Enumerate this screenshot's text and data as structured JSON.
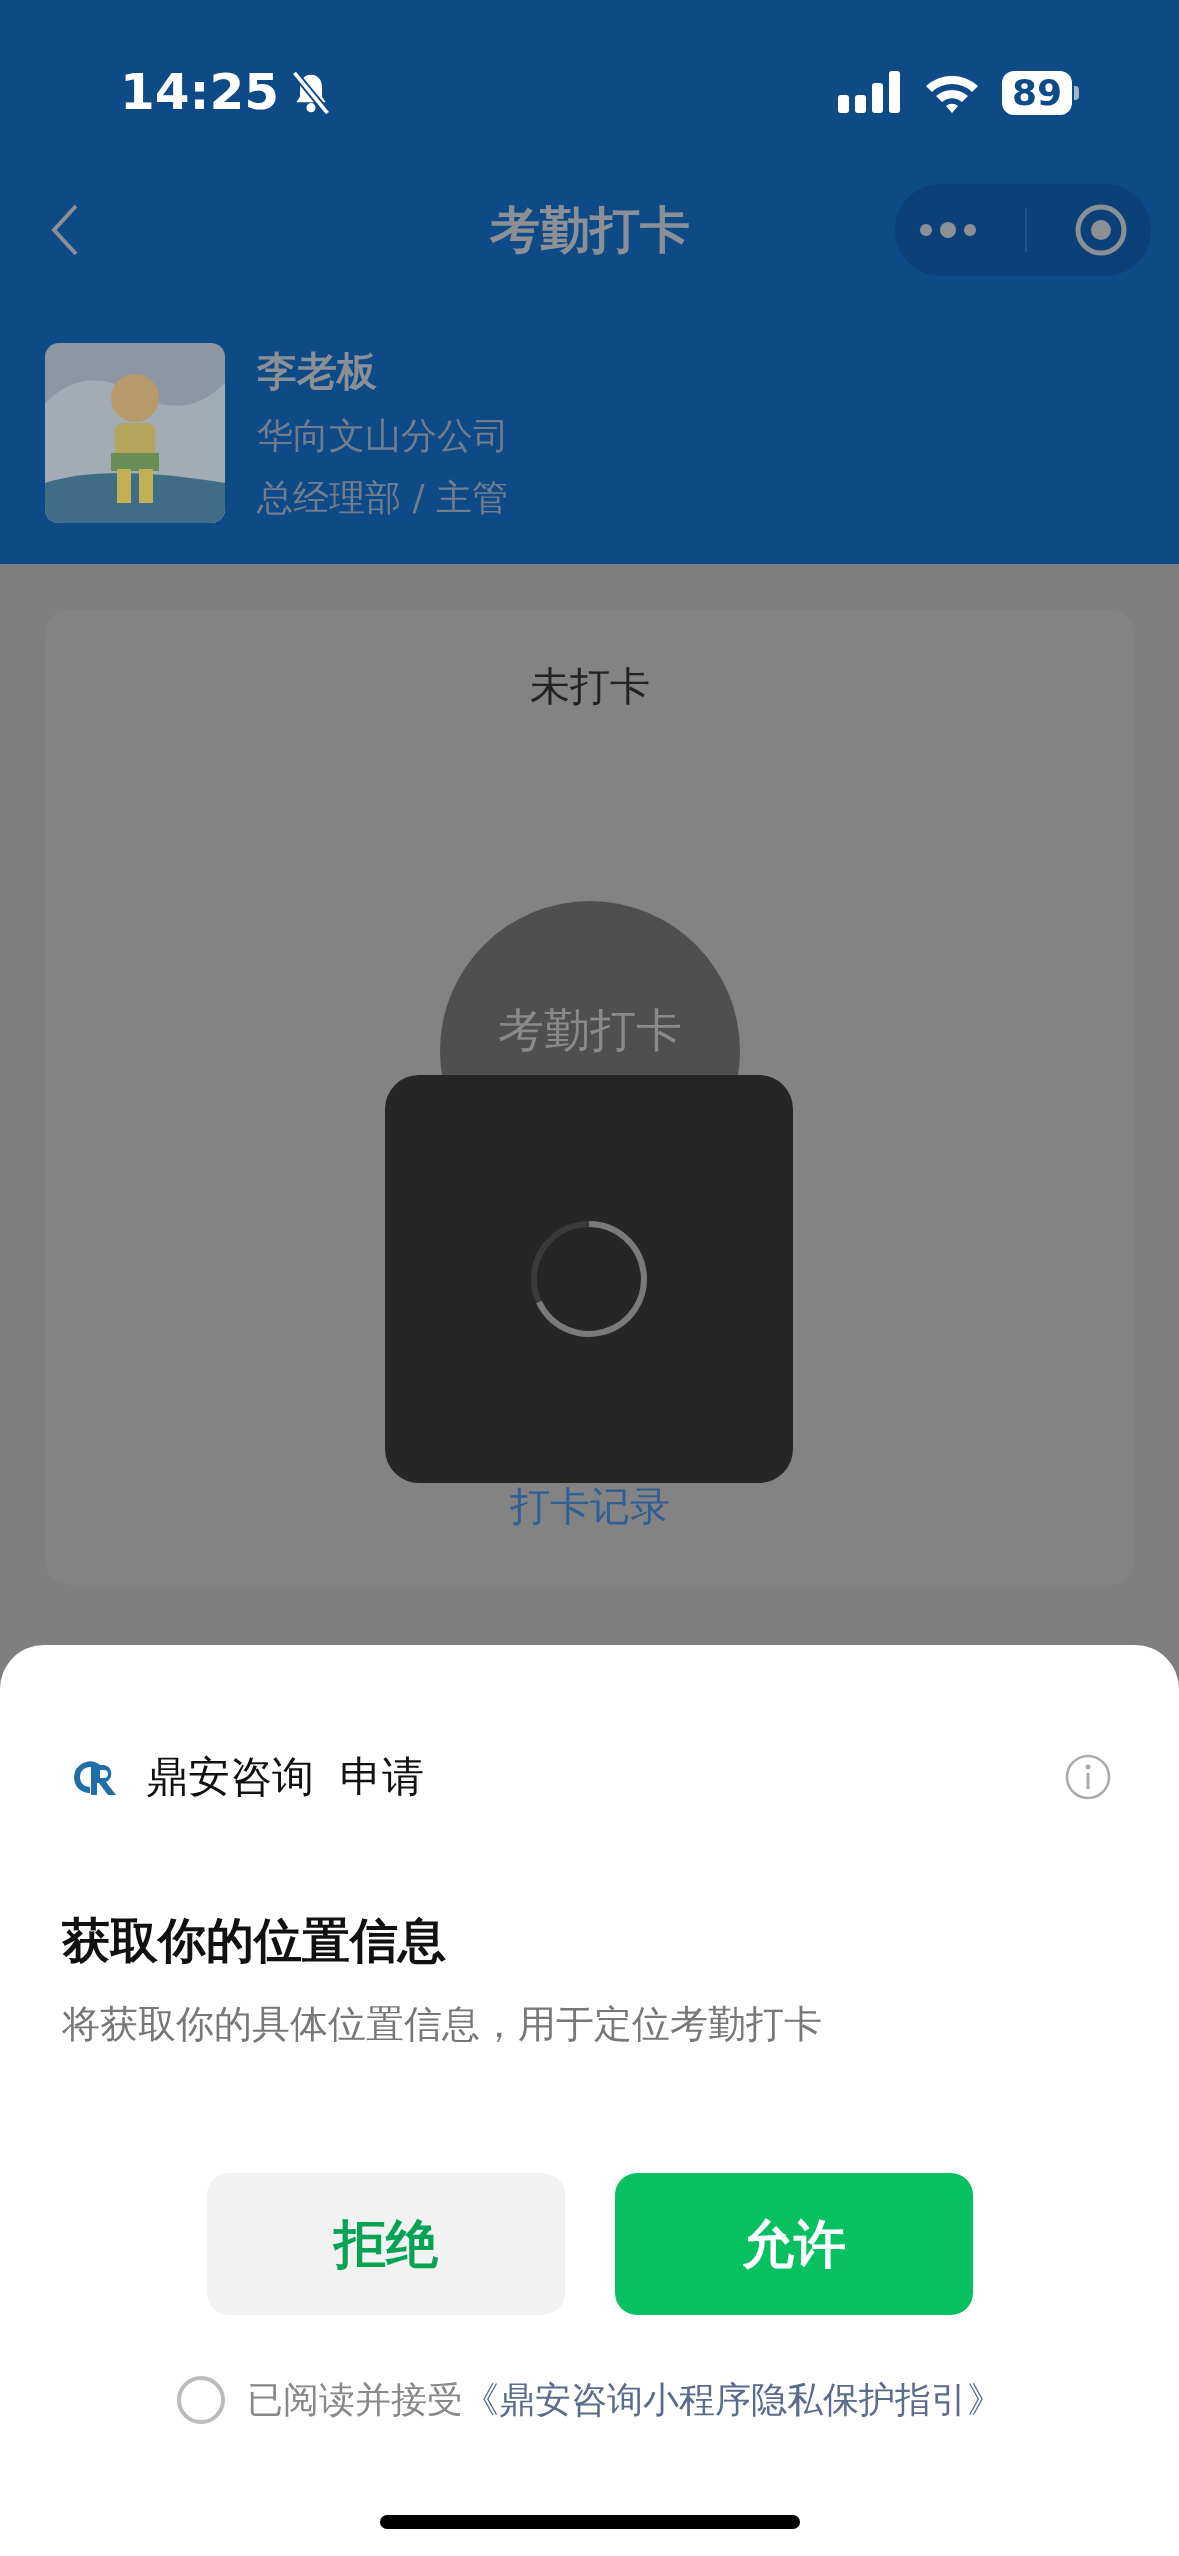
{
  "status_bar": {
    "time": "14:25",
    "battery": "89",
    "muted": true
  },
  "nav": {
    "title": "考勤打卡"
  },
  "profile": {
    "name": "李老板",
    "company": "华向文山分公司",
    "department": "总经理部 / 主管"
  },
  "card": {
    "status": "未打卡",
    "punch_button": "考勤打卡",
    "records_link": "打卡记录"
  },
  "loading": true,
  "sheet": {
    "app_name": "鼎安咨询",
    "request": "申请",
    "title": "获取你的位置信息",
    "description": "将获取你的具体位置信息，用于定位考勤打卡",
    "buttons": [
      {
        "label": "拒绝",
        "kind": "secondary"
      },
      {
        "label": "允许",
        "kind": "primary"
      }
    ],
    "agreement": {
      "checked": false,
      "prefix": "已阅读并接受",
      "link": "《鼎安咨询小程序隐私保护指引》"
    }
  }
}
